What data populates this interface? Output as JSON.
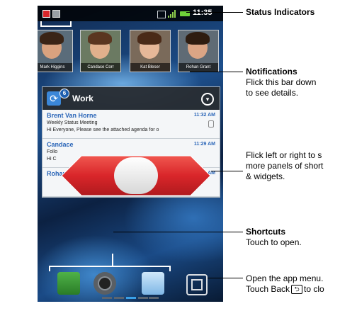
{
  "status_bar": {
    "time": "11:35",
    "icons": [
      "notification-alert-icon",
      "notification-generic-icon",
      "signal-icon",
      "battery-icon"
    ]
  },
  "contacts": [
    {
      "name": "Mark Higgins"
    },
    {
      "name": "Candace Corr"
    },
    {
      "name": "Kat Bleser"
    },
    {
      "name": "Rohan Grant"
    }
  ],
  "widget": {
    "title": "Work",
    "unread_count": "6",
    "emails": [
      {
        "from": "Brent Van Horne",
        "time": "11:32 AM",
        "subject": "Weekly Status Meeting",
        "preview": "Hi Everyone, Please see the attached agenda for o"
      },
      {
        "from": "Candace",
        "time": "11:29 AM",
        "subject": "Follo",
        "preview": "Hi C"
      },
      {
        "from": "Rohan Grant",
        "time": "11:25 AM",
        "subject": "",
        "preview": ""
      }
    ]
  },
  "dock": [
    "phone-icon",
    "camera-icon",
    "email-icon",
    "app-menu-icon"
  ],
  "colors": {
    "swipe_arrow": "#d9262a",
    "email_sender": "#2b66b8",
    "status_battery": "#6fd23a"
  },
  "callouts": {
    "status": {
      "title": "Status Indicators"
    },
    "notifications": {
      "title": "Notifications",
      "line1": "Flick this bar down",
      "line2": "to see details."
    },
    "panels": {
      "line1": "Flick left or right to s",
      "line2": "more panels of short",
      "line3": "& widgets."
    },
    "shortcuts": {
      "title": "Shortcuts",
      "line1": "Touch to open."
    },
    "appmenu": {
      "line1": "Open the app menu.",
      "line2_prefix": "Touch Back",
      "line2_suffix": "to clo"
    }
  }
}
